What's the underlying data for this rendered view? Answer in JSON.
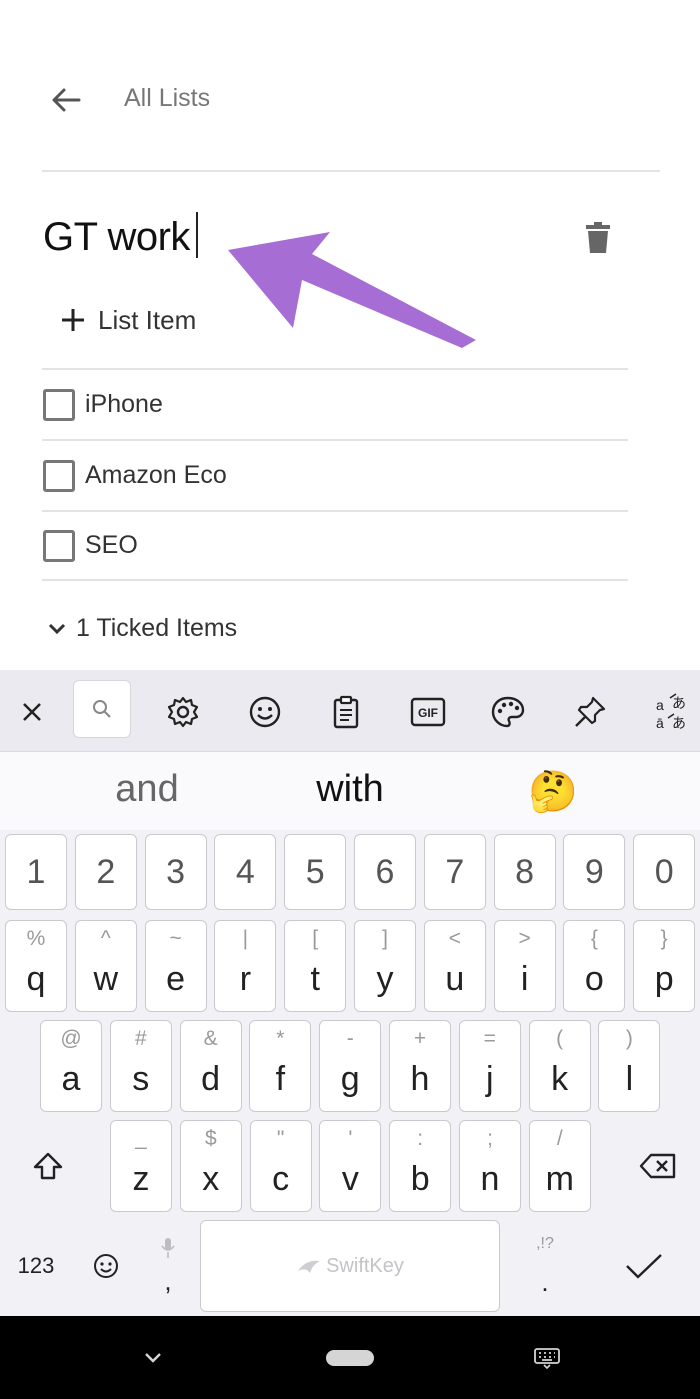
{
  "header": {
    "back_label": "All Lists"
  },
  "list": {
    "title": "GT work",
    "add_item_label": "List Item",
    "items": [
      {
        "label": "iPhone",
        "checked": false
      },
      {
        "label": "Amazon Eco",
        "checked": false
      },
      {
        "label": "SEO",
        "checked": false
      }
    ],
    "ticked_label": "1 Ticked Items"
  },
  "annotation": {
    "arrow_color": "#A66DD4"
  },
  "keyboard": {
    "toolbar": [
      "close-icon",
      "search-icon",
      "settings-icon",
      "emoji-icon",
      "clipboard-icon",
      "gif-icon",
      "theme-palette-icon",
      "pin-icon",
      "translate-icon"
    ],
    "gif_label": "GIF",
    "predictions": [
      "and",
      "with",
      "🤔"
    ],
    "number_row": [
      "1",
      "2",
      "3",
      "4",
      "5",
      "6",
      "7",
      "8",
      "9",
      "0"
    ],
    "row1": [
      {
        "sub": "%",
        "key": "q"
      },
      {
        "sub": "^",
        "key": "w"
      },
      {
        "sub": "~",
        "key": "e"
      },
      {
        "sub": "|",
        "key": "r"
      },
      {
        "sub": "[",
        "key": "t"
      },
      {
        "sub": "]",
        "key": "y"
      },
      {
        "sub": "<",
        "key": "u"
      },
      {
        "sub": ">",
        "key": "i"
      },
      {
        "sub": "{",
        "key": "o"
      },
      {
        "sub": "}",
        "key": "p"
      }
    ],
    "row2": [
      {
        "sub": "@",
        "key": "a"
      },
      {
        "sub": "#",
        "key": "s"
      },
      {
        "sub": "&",
        "key": "d"
      },
      {
        "sub": "*",
        "key": "f"
      },
      {
        "sub": "-",
        "key": "g"
      },
      {
        "sub": "+",
        "key": "h"
      },
      {
        "sub": "=",
        "key": "j"
      },
      {
        "sub": "(",
        "key": "k"
      },
      {
        "sub": ")",
        "key": "l"
      }
    ],
    "row3": [
      {
        "sub": "_",
        "key": "z"
      },
      {
        "sub": "$",
        "key": "x"
      },
      {
        "sub": "\"",
        "key": "c"
      },
      {
        "sub": "'",
        "key": "v"
      },
      {
        "sub": ":",
        "key": "b"
      },
      {
        "sub": ";",
        "key": "n"
      },
      {
        "sub": "/",
        "key": "m"
      }
    ],
    "numbers_key": "123",
    "comma_key": ",",
    "period_key": ".",
    "period_sub": ",!?",
    "space_brand": "SwiftKey"
  }
}
